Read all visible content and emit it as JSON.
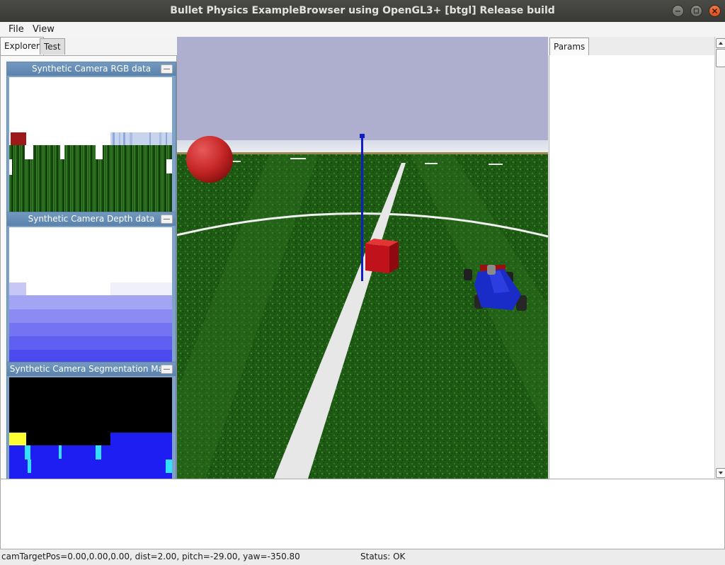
{
  "window": {
    "title": "Bullet Physics ExampleBrowser using OpenGL3+ [btgl] Release build",
    "buttons": [
      "minimize-icon",
      "maximize-icon",
      "close-icon"
    ]
  },
  "menu": {
    "items": [
      "File",
      "View"
    ]
  },
  "explorer": {
    "tabs": [
      "Explorer",
      "Test"
    ],
    "active_tab": "Explorer"
  },
  "camera_windows": [
    {
      "title": "Synthetic Camera RGB data"
    },
    {
      "title": "Synthetic Camera Depth data"
    },
    {
      "title": "Synthetic Camera Segmentation Mask"
    }
  ],
  "params": {
    "tab": "Params"
  },
  "status": {
    "camera": "camTargetPos=0.00,0.00,0.00, dist=2.00, pitch=-29.00, yaw=-350.80",
    "state": "Status: OK"
  },
  "colors": {
    "sky": "#aeaece",
    "grass": "#1f5a14",
    "sphere": "#cc2a2a",
    "cube": "#c0121b",
    "pole": "#0c1ec4",
    "racecar": "#1a2cc8",
    "depth_near": "#4b4bf0",
    "segmentation_yellow": "#ffff33",
    "segmentation_cyan": "#33e0ff",
    "segmentation_blue": "#1e1ef2"
  }
}
